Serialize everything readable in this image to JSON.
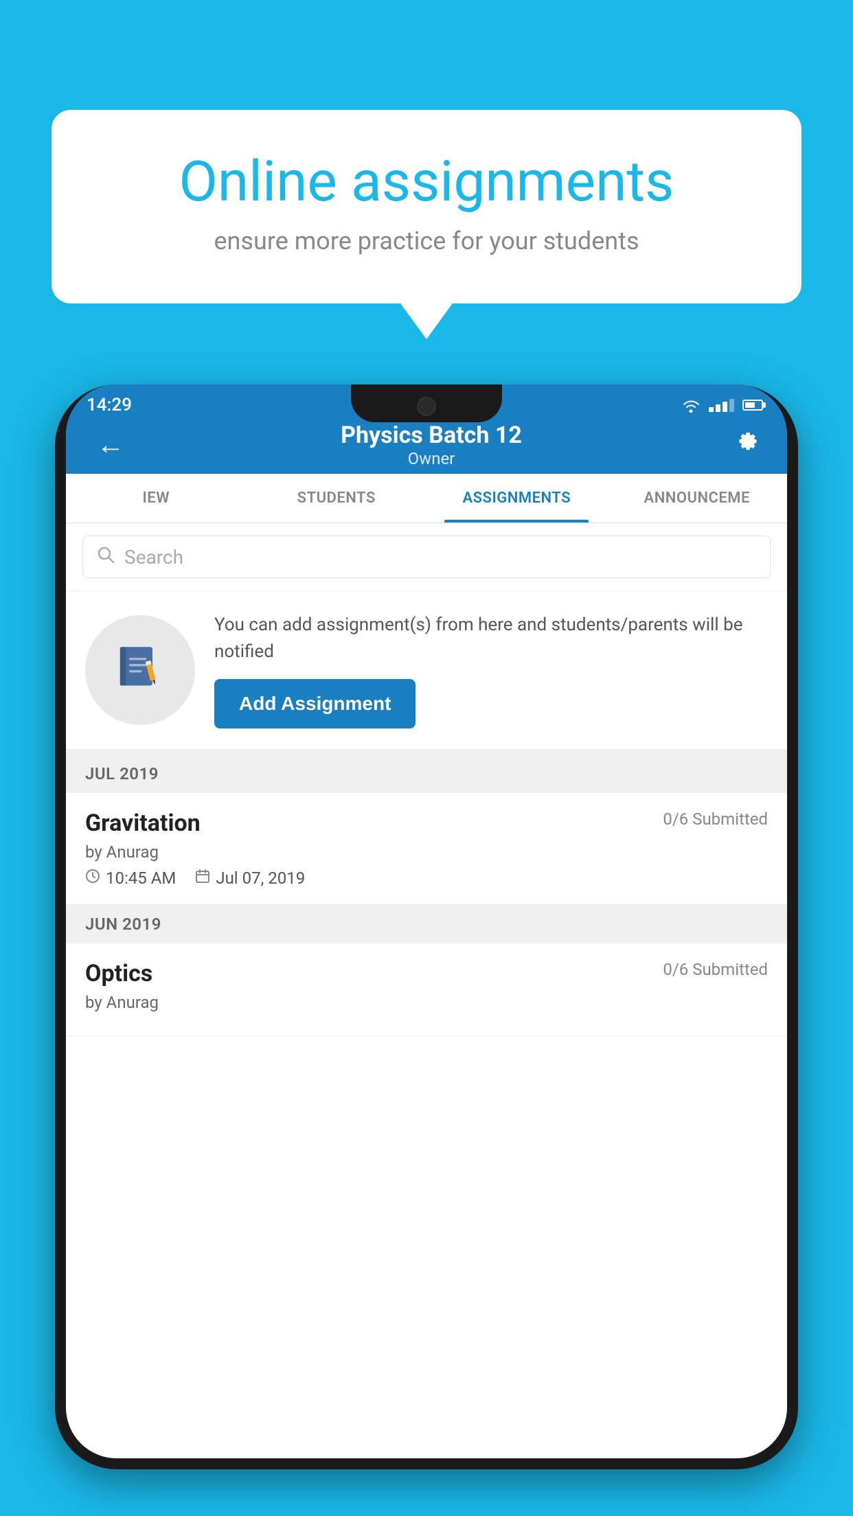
{
  "background": {
    "color": "#1ab8e8"
  },
  "speech_bubble": {
    "title": "Online assignments",
    "subtitle": "ensure more practice for your students"
  },
  "status_bar": {
    "time": "14:29"
  },
  "app_bar": {
    "title": "Physics Batch 12",
    "subtitle": "Owner",
    "back_label": "←",
    "settings_label": "⚙"
  },
  "tabs": [
    {
      "label": "IEW",
      "active": false
    },
    {
      "label": "STUDENTS",
      "active": false
    },
    {
      "label": "ASSIGNMENTS",
      "active": true
    },
    {
      "label": "ANNOUNCEME",
      "active": false
    }
  ],
  "search": {
    "placeholder": "Search"
  },
  "promo": {
    "text": "You can add assignment(s) from here and students/parents will be notified",
    "button_label": "Add Assignment"
  },
  "sections": [
    {
      "label": "JUL 2019",
      "assignments": [
        {
          "name": "Gravitation",
          "submitted": "0/6 Submitted",
          "by": "by Anurag",
          "time": "10:45 AM",
          "date": "Jul 07, 2019"
        }
      ]
    },
    {
      "label": "JUN 2019",
      "assignments": [
        {
          "name": "Optics",
          "submitted": "0/6 Submitted",
          "by": "by Anurag",
          "time": "",
          "date": ""
        }
      ]
    }
  ]
}
